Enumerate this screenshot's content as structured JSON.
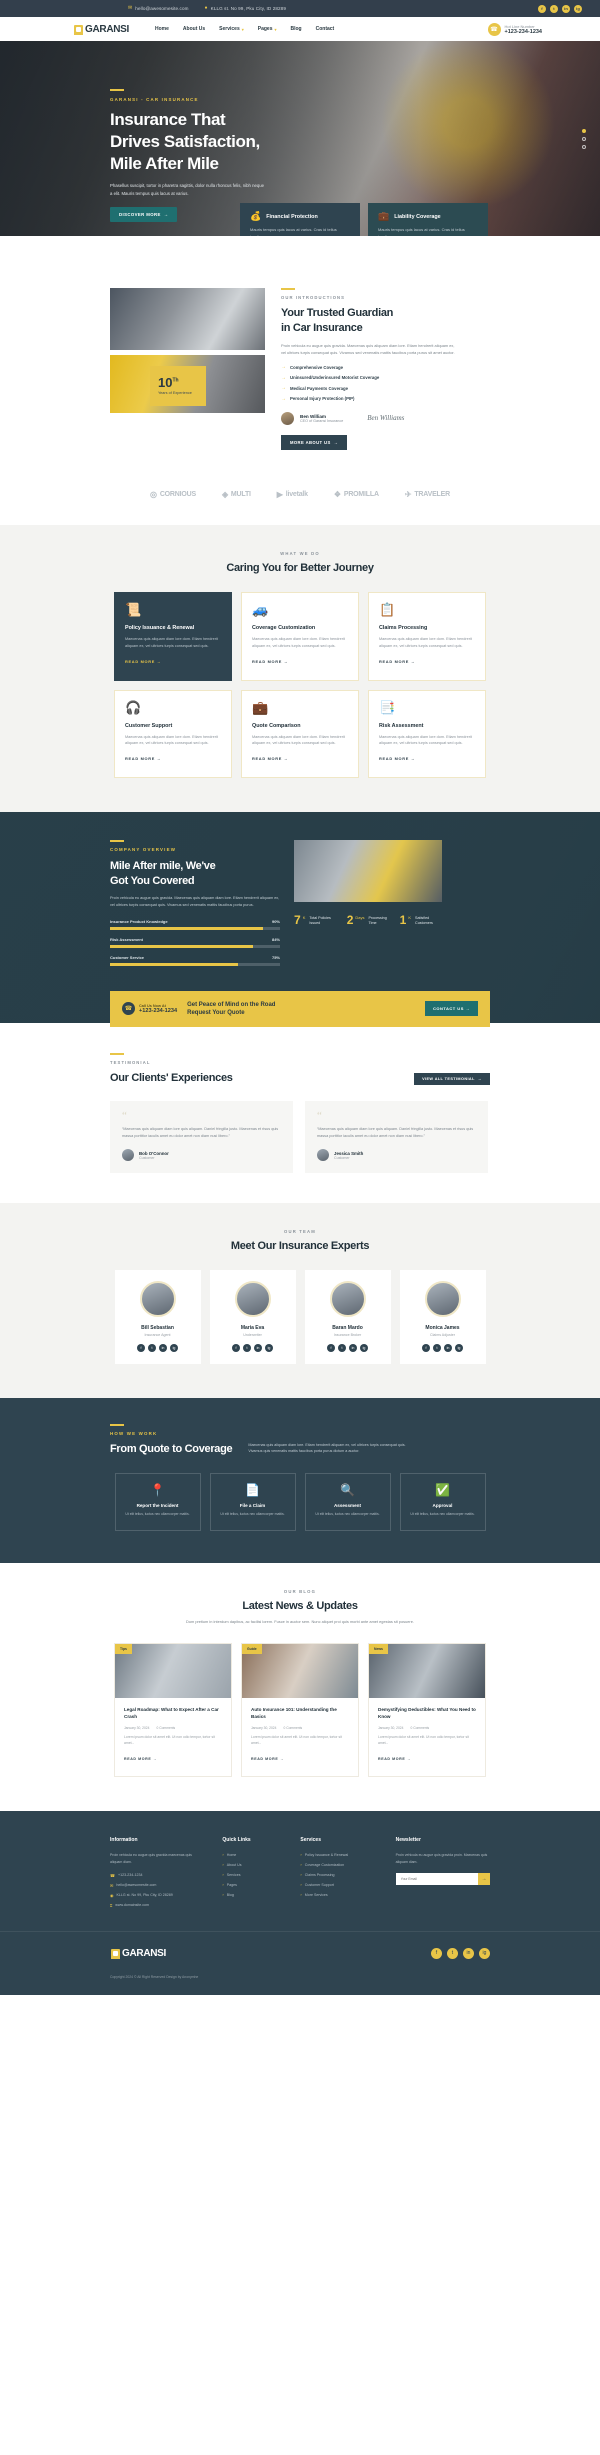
{
  "topbar": {
    "email": "hello@awesomesite.com",
    "address": "KLLG st. No 99, Pku City, ID 28289",
    "socials": [
      "f",
      "t",
      "in",
      "ig"
    ]
  },
  "nav": {
    "brand": "GARANSI",
    "menu": [
      {
        "label": "Home",
        "caret": false
      },
      {
        "label": "About Us",
        "caret": false
      },
      {
        "label": "Services",
        "caret": true
      },
      {
        "label": "Pages",
        "caret": true
      },
      {
        "label": "Blog",
        "caret": false
      },
      {
        "label": "Contact",
        "caret": false
      }
    ],
    "hotline_label": "Hot Line Number",
    "hotline_number": "+123-234-1234"
  },
  "hero": {
    "kicker": "GARANSI - CAR INSURANCE",
    "title_line1": "Insurance That",
    "title_line2": "Drives Satisfaction,",
    "title_line3": "Mile After Mile",
    "paragraph": "Phasellus suscipit, tortor in pharetra sagittis, dolor nulla rhoncus felis, nibh neque a elit. Mauris tempus quis lacus at varius.",
    "cta": "DISCOVER MORE",
    "features": [
      {
        "icon": "shield",
        "title": "Financial Protection",
        "text": "Mauris tempus quis lacus at varius. Cras id tellus iaculis, semper quam."
      },
      {
        "icon": "briefcase",
        "title": "Liability Coverage",
        "text": "Mauris tempus quis lacus at varius. Cras id tellus iaculis, semper quam."
      }
    ]
  },
  "intro": {
    "eyebrow": "OUR INTRODUCTIONS",
    "title_line1": "Your Trusted Guardian",
    "title_line2": "in Car Insurance",
    "paragraph": "Proin vehicula eu augue quis gravida. Maecenas quis aliquam diam lore. Etiam hendrerit aliquam ex, vel ultrices turpis consequat quis. Vivamus sed venenatis mattis faucibus porta purus sit amet auctor.",
    "ticks": [
      "Comprehensive Coverage",
      "Uninsured/Underinsured Motorist Coverage",
      "Medical Payments Coverage",
      "Personal Injury Protection (PIP)"
    ],
    "badge_number": "10",
    "badge_sup": "Th",
    "badge_label": "Years of Experience",
    "author_name": "Ben William",
    "author_role": "CEO of Garansi Insurance",
    "signature": "Ben Williams",
    "cta": "MORE ABOUT US"
  },
  "brands": [
    {
      "icon": "◎",
      "name": "CORNIOUS"
    },
    {
      "icon": "◈",
      "name": "MULTI"
    },
    {
      "icon": "▶",
      "name": "livetalk"
    },
    {
      "icon": "❖",
      "name": "PROMILLA"
    },
    {
      "icon": "✈",
      "name": "TRAVELER"
    }
  ],
  "services": {
    "eyebrow": "WHAT WE DO",
    "title": "Caring You for Better Journey",
    "read_more": "READ MORE",
    "cards": [
      {
        "icon": "📜",
        "title": "Policy Issuance & Renewal",
        "text": "Maecenas quis aliquam diam lore dom. Etiam hendrerit aliquam ex, vel ultrices turpis consequat sed quis."
      },
      {
        "icon": "🚙",
        "title": "Coverage Customization",
        "text": "Maecenas quis aliquam diam lore dom. Etiam hendrerit aliquam ex, vel ultrices turpis consequat sed quis."
      },
      {
        "icon": "📋",
        "title": "Claims Processing",
        "text": "Maecenas quis aliquam diam lore dom. Etiam hendrerit aliquam ex, vel ultrices turpis consequat sed quis."
      },
      {
        "icon": "🎧",
        "title": "Customer Support",
        "text": "Maecenas quis aliquam diam lore dom. Etiam hendrerit aliquam ex, vel ultrices turpis consequat sed quis."
      },
      {
        "icon": "💼",
        "title": "Quote Comparison",
        "text": "Maecenas quis aliquam diam lore dom. Etiam hendrerit aliquam ex, vel ultrices turpis consequat sed quis."
      },
      {
        "icon": "📑",
        "title": "Risk Assessment",
        "text": "Maecenas quis aliquam diam lore dom. Etiam hendrerit aliquam ex, vel ultrices turpis consequat sed quis."
      }
    ]
  },
  "why": {
    "eyebrow": "COMPANY OVERVIEW",
    "title_line1": "Mile After mile, We've",
    "title_line2": "Got You Covered",
    "paragraph": "Proin vehicula eu augue quis gravida. Maecenas quis aliquam diam lore. Etiam hendrerit aliquam ex, vel ultrices turpis consequat quis. Vivamus sed venenatis mattis faucibus porta purus.",
    "bars": [
      {
        "label": "Insurance Product Knowledge",
        "value": "90%",
        "pct": 90
      },
      {
        "label": "Risk Assessment",
        "value": "84%",
        "pct": 84
      },
      {
        "label": "Customer Service",
        "value": "75%",
        "pct": 75
      }
    ],
    "counters": [
      {
        "number": "7",
        "suffix": "K",
        "label": "Total Policies Issued"
      },
      {
        "number": "2",
        "suffix": "",
        "label": "Processing Time",
        "unit": "Days"
      },
      {
        "number": "1",
        "suffix": "K",
        "label": "Satisfied Customers"
      }
    ]
  },
  "cta": {
    "call_label": "Call Us Now At",
    "call_number": "+123-234-1234",
    "line1": "Get Peace of Mind on the Road",
    "line2": "Request Your Quote",
    "button": "CONTACT US"
  },
  "testimonials": {
    "eyebrow": "TESTIMONIAL",
    "title": "Our Clients' Experiences",
    "button": "VIEW ALL TESTIMONIAL",
    "items": [
      {
        "quote": "“Maecenas quis aliquam diam lore quis aliquam. Daniel fringilla justo. Maecenas et risus quis massa porttitor iaculis amet eu dolor amet non diam nusi libero.”",
        "name": "Bob O'Connor",
        "role": "Customer"
      },
      {
        "quote": "“Maecenas quis aliquam diam lore quis aliquam. Daniel fringilla justo. Maecenas et risus quis massa porttitor iaculis amet eu dolor amet non diam nusi libero.”",
        "name": "Jessica Smith",
        "role": "Customer"
      }
    ]
  },
  "team": {
    "eyebrow": "OUR TEAM",
    "title": "Meet Our Insurance Experts",
    "members": [
      {
        "name": "Bill Sebastian",
        "role": "Insurance Agent"
      },
      {
        "name": "Maria Eva",
        "role": "Underwriter"
      },
      {
        "name": "Baran Mardo",
        "role": "Insurance Broker"
      },
      {
        "name": "Monica James",
        "role": "Claims Adjuster"
      }
    ],
    "socials": [
      "f",
      "t",
      "in",
      "ig"
    ]
  },
  "process": {
    "eyebrow": "HOW WE WORK",
    "title": "From Quote to Coverage",
    "paragraph": "Maecenas quis aliquam diam lore. Etiam hendrerit aliquam ex, vel ultrices turpis consequat quis. Vivamus quis venenatis mattis faucibus porta purus dictum a auctor.",
    "steps": [
      {
        "icon": "📍",
        "title": "Report the Incident",
        "text": "Ut elit tellus, luctus nec ullamcorper mattis."
      },
      {
        "icon": "📄",
        "title": "File a Claim",
        "text": "Ut elit tellus, luctus nec ullamcorper mattis."
      },
      {
        "icon": "🔍",
        "title": "Assessment",
        "text": "Ut elit tellus, luctus nec ullamcorper mattis."
      },
      {
        "icon": "✅",
        "title": "Approval",
        "text": "Ut elit tellus, luctus nec ullamcorper mattis."
      }
    ]
  },
  "blog": {
    "eyebrow": "OUR BLOG",
    "title": "Latest News & Updates",
    "subtitle": "Dum pretium in interdum dapibus, ac facilisi lorem. Fusce in auctor sem. Nunc aliquet proi quis morbi ante amet egestas sit posuere.",
    "read_more": "READ MORE",
    "posts": [
      {
        "tag": "Tips",
        "title": "Legal Roadmap: What to Expect After a Car Crash",
        "date": "January 30, 2024",
        "comments": "0 Comments",
        "text": "Lorem ipsum dolor sit amet elit. Ut non odio tempor, tortor sit amet..."
      },
      {
        "tag": "Guide",
        "title": "Auto Insurance 101: Understanding the Basics",
        "date": "January 30, 2024",
        "comments": "0 Comments",
        "text": "Lorem ipsum dolor sit amet elit. Ut non odio tempor, tortor sit amet..."
      },
      {
        "tag": "News",
        "title": "Demystifying Deductibles: What You Need to Know",
        "date": "January 30, 2024",
        "comments": "0 Comments",
        "text": "Lorem ipsum dolor sit amet elit. Ut non odio tempor, tortor sit amet..."
      }
    ]
  },
  "footer": {
    "col1_title": "Information",
    "col1_text": "Proin vehicula eu augue quis gravida maecenas quis aliquam diam.",
    "contacts": [
      {
        "icon": "☎",
        "text": "+123-234-1234"
      },
      {
        "icon": "✉",
        "text": "hello@awesomesite.com"
      },
      {
        "icon": "◉",
        "text": "KLLG st. No 99, Pku City, ID 28289"
      },
      {
        "icon": "⌗",
        "text": "www.domainsite.com"
      }
    ],
    "col2_title": "Quick Links",
    "quick_links": [
      "Home",
      "About Us",
      "Services",
      "Pages",
      "Blog"
    ],
    "col3_title": "Services",
    "services_links": [
      "Policy Issuance & Renewal",
      "Coverage Customization",
      "Claims Processing",
      "Customer Support",
      "More Services"
    ],
    "col4_title": "Newsletter",
    "col4_text": "Proin vehicula eu augue quis gravida proin. Maecenas quis aliquam diam.",
    "newsletter_placeholder": "Your Email",
    "brand": "GARANSI",
    "socials": [
      "f",
      "t",
      "in",
      "ig"
    ],
    "copyright": "Copyright 2024 © All Right Reserved Design by Anonymhe"
  }
}
